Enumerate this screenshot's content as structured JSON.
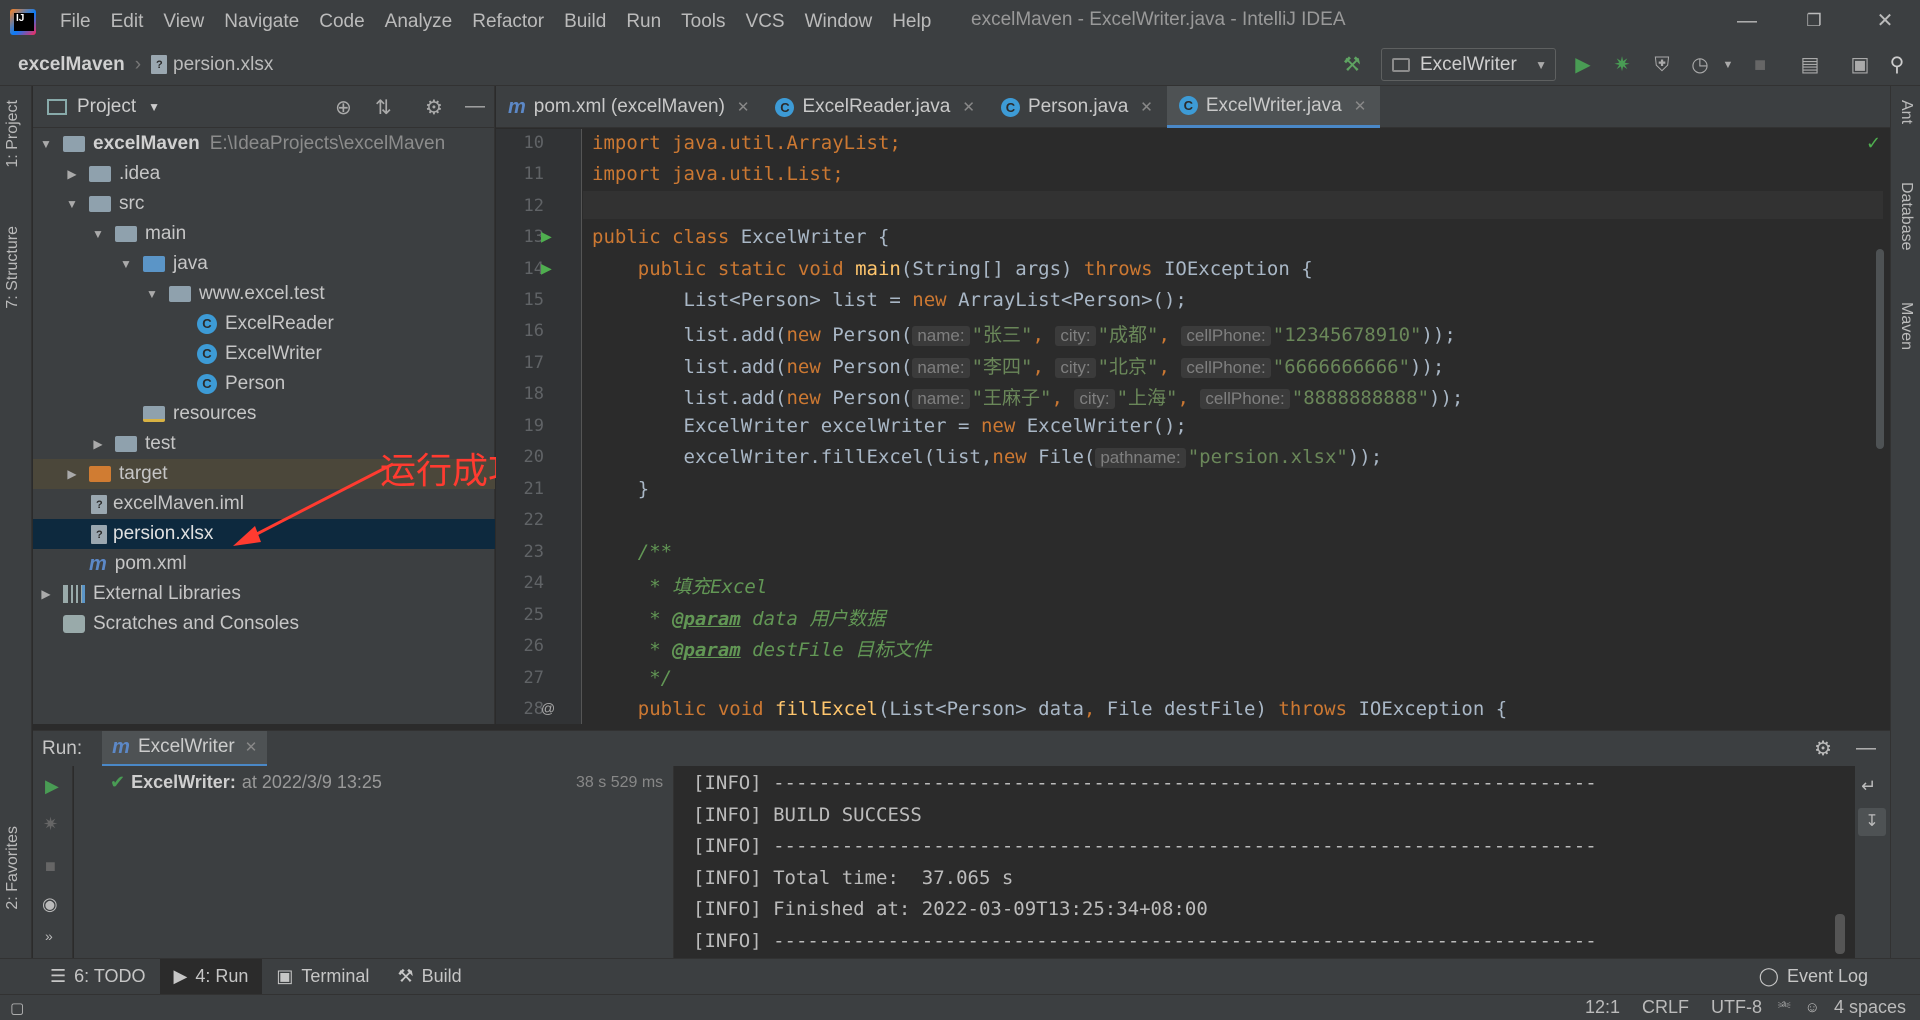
{
  "window": {
    "title": "excelMaven - ExcelWriter.java - IntelliJ IDEA"
  },
  "menu": [
    "File",
    "Edit",
    "View",
    "Navigate",
    "Code",
    "Analyze",
    "Refactor",
    "Build",
    "Run",
    "Tools",
    "VCS",
    "Window",
    "Help"
  ],
  "breadcrumbs": {
    "project": "excelMaven",
    "file": "persion.xlsx"
  },
  "run_config": {
    "name": "ExcelWriter"
  },
  "left_tabs": {
    "project": "1: Project",
    "structure": "7: Structure",
    "favorites": "2: Favorites"
  },
  "right_tabs": {
    "ant": "Ant",
    "database": "Database",
    "maven": "Maven"
  },
  "project_panel": {
    "title": "Project",
    "tree": [
      {
        "label": "excelMaven",
        "path": "E:\\IdeaProjects\\excelMaven"
      },
      {
        "label": ".idea"
      },
      {
        "label": "src"
      },
      {
        "label": "main"
      },
      {
        "label": "java"
      },
      {
        "label": "www.excel.test"
      },
      {
        "label": "ExcelReader"
      },
      {
        "label": "ExcelWriter"
      },
      {
        "label": "Person"
      },
      {
        "label": "resources"
      },
      {
        "label": "test"
      },
      {
        "label": "target"
      },
      {
        "label": "excelMaven.iml"
      },
      {
        "label": "persion.xlsx"
      },
      {
        "label": "pom.xml"
      },
      {
        "label": "External Libraries"
      },
      {
        "label": "Scratches and Consoles"
      }
    ]
  },
  "annotation": "运行成功",
  "editor_tabs": [
    {
      "label": "pom.xml (excelMaven)"
    },
    {
      "label": "ExcelReader.java"
    },
    {
      "label": "Person.java"
    },
    {
      "label": "ExcelWriter.java"
    }
  ],
  "code": {
    "line_numbers": [
      "10",
      "11",
      "12",
      "13",
      "14",
      "15",
      "16",
      "17",
      "18",
      "19",
      "20",
      "21",
      "22",
      "23",
      "24",
      "25",
      "26",
      "27",
      "28"
    ],
    "l10": "import java.util.ArrayList;",
    "l11": "import java.util.List;",
    "l13a": "public class ",
    "l13b": "ExcelWriter {",
    "l14a": "    public static void ",
    "l14b": "main",
    "l14c": "(String[] args) ",
    "l14d": "throws ",
    "l14e": "IOException {",
    "l15a": "        List<Person> list = ",
    "l15b": "new ",
    "l15c": "ArrayList<Person>();",
    "add": "        list.add(",
    "new": "new ",
    "person": "Person(",
    "hint_name": "name:",
    "hint_city": "city:",
    "hint_phone": "cellPhone:",
    "hint_path": "pathname:",
    "r16_name": "\"张三\"",
    "r16_city": "\"成都\"",
    "r16_phone": "\"12345678910\"",
    "r17_name": "\"李四\"",
    "r17_city": "\"北京\"",
    "r17_phone": "\"6666666666\"",
    "r18_name": "\"王麻子\"",
    "r18_city": "\"上海\"",
    "r18_phone": "\"8888888888\"",
    "close": "));",
    "l19a": "        ExcelWriter excelWriter = ",
    "l19b": "new ",
    "l19c": "ExcelWriter();",
    "l20a": "        excelWriter.fillExcel(list,",
    "l20b": "new ",
    "l20c": "File(",
    "l20d": "\"persion.xlsx\"",
    "l20e": "));",
    "l21": "    }",
    "l23": "    /**",
    "l24": "     * 填充Excel",
    "l25a": "     * ",
    "l25b": "@param",
    "l25c": " data 用户数据",
    "l26a": "     * ",
    "l26b": "@param",
    "l26c": " destFile 目标文件",
    "l27": "     */",
    "l28a": "    public void ",
    "l28b": "fillExcel",
    "l28c": "(List<Person> data",
    "l28d": ", ",
    "l28e": "File destFile) ",
    "l28f": "throws ",
    "l28g": "IOException {"
  },
  "run_panel": {
    "label": "Run:",
    "tab": "ExcelWriter",
    "tree_item": "ExcelWriter:",
    "tree_time": "at 2022/3/9 13:25",
    "duration": "38 s 529 ms",
    "console": [
      "[INFO] ------------------------------------------------------------------------",
      "[INFO] BUILD SUCCESS",
      "[INFO] ------------------------------------------------------------------------",
      "[INFO] Total time:  37.065 s",
      "[INFO] Finished at: 2022-03-09T13:25:34+08:00",
      "[INFO] ------------------------------------------------------------------------"
    ]
  },
  "bottom_tabs": {
    "todo": "6: TODO",
    "run": "4: Run",
    "terminal": "Terminal",
    "build": "Build",
    "event_log": "Event Log"
  },
  "status": {
    "position": "12:1",
    "line_sep": "CRLF",
    "encoding": "UTF-8",
    "indent": "4 spaces"
  },
  "colors": {
    "accent": "#4a88c7",
    "run_green": "#499c54",
    "annotation": "#ff3b30"
  }
}
